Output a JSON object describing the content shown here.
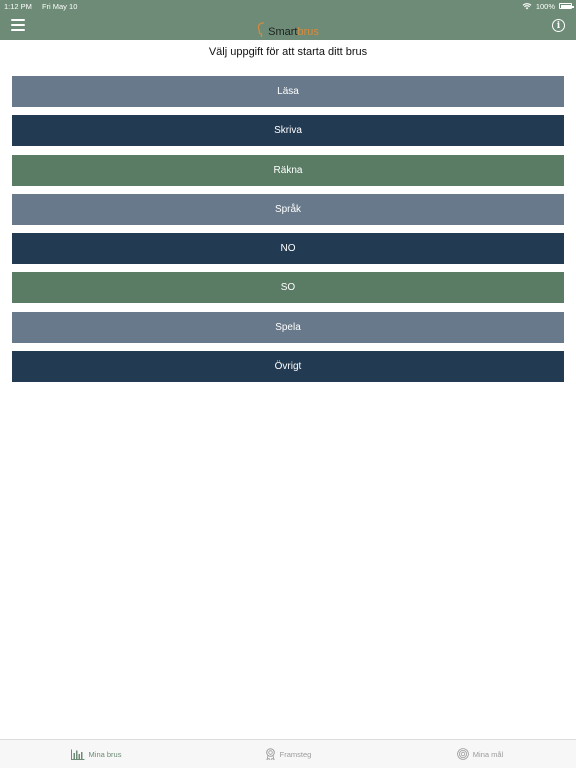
{
  "status": {
    "time": "1:12 PM",
    "date": "Fri May 10",
    "battery": "100%"
  },
  "logo": {
    "part1": "Smart",
    "part2": "brus"
  },
  "prompt": "Välj uppgift för att starta ditt brus",
  "tasks": [
    {
      "label": "Läsa",
      "color": "#67798a"
    },
    {
      "label": "Skriva",
      "color": "#223a52"
    },
    {
      "label": "Räkna",
      "color": "#5a7c65"
    },
    {
      "label": "Språk",
      "color": "#67798a"
    },
    {
      "label": "NO",
      "color": "#223a52"
    },
    {
      "label": "SO",
      "color": "#5a7c65"
    },
    {
      "label": "Spela",
      "color": "#67798a"
    },
    {
      "label": "Övrigt",
      "color": "#223a52"
    }
  ],
  "tabs": [
    {
      "label": "Mina brus",
      "icon": "bar-chart-icon",
      "active": true
    },
    {
      "label": "Framsteg",
      "icon": "medal-icon",
      "active": false
    },
    {
      "label": "Mina mål",
      "icon": "target-icon",
      "active": false
    }
  ],
  "colors": {
    "header": "#6d8b76",
    "accent_orange": "#d98a3c"
  }
}
